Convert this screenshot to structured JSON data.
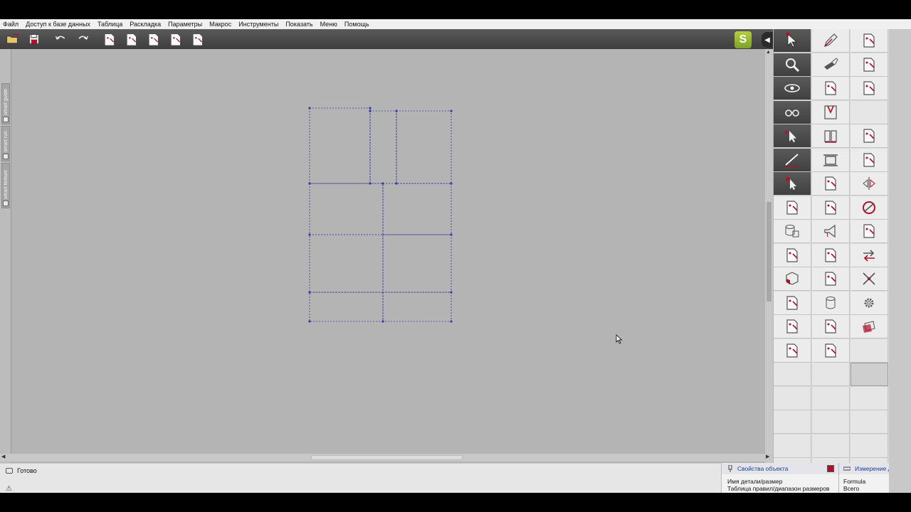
{
  "menu": {
    "items": [
      "Файл",
      "Доступ к базе данных",
      "Таблица",
      "Раскладка",
      "Параметры",
      "Макрос",
      "Инструменты",
      "Показать",
      "Меню",
      "Помощь"
    ]
  },
  "toolbar": {
    "buttons": [
      "open-file-icon",
      "save-icon",
      "undo-icon",
      "redo-icon",
      "layout-icon",
      "delete-pieces-icon",
      "list-icon",
      "piece-icon",
      "grid-icon"
    ],
    "logo": "S",
    "collapse": "◀"
  },
  "left_tabs": [
    "smart guide",
    "smart run",
    "smart texture"
  ],
  "palette": {
    "columns": [
      [
        "select-arrow-icon",
        "zoom-icon",
        "eye-icon",
        "glasses-icon",
        "add-point-arrow-icon",
        "edit-line-icon",
        "magnet-arrow-icon",
        "cross-piece-icon",
        "database-icon",
        "piece-corner-icon",
        "cube-icon",
        "piece-list-icon",
        "view-piece-icon",
        "search-piece-icon"
      ],
      [
        "pen-icon",
        "brush-icon",
        "piece-icon",
        "v-notch-icon",
        "book-icon",
        "frame-icon",
        "grid-piece-icon",
        "edit-piece-icon",
        "megaphone-icon",
        "grade-icon",
        "piece-edit-icon",
        "cylinder-icon",
        "piece-arrow-icon",
        "piece-point-icon"
      ],
      [
        "abc-piece-icon",
        "dashed-piece-icon",
        "piece-export-icon",
        "",
        "piece-plus-icon",
        "piece-arrow-right-icon",
        "mirror-icon",
        "circle-tool-icon",
        "piece-blank-icon",
        "swap-icon",
        "split-icon",
        "gear-icon",
        "stack-icon",
        ""
      ]
    ]
  },
  "status": {
    "text": "Готово",
    "warning_icon": "⚠"
  },
  "properties": {
    "title": "Свойства объекта",
    "rows": [
      "Имя детали/размер",
      "Таблица правил/диапазон размеров"
    ]
  },
  "measurement": {
    "title": "Измерение д",
    "rows": [
      "Formula",
      "Всего"
    ]
  },
  "colors": {
    "accent": "#b0102a",
    "marker_lines": "#3a3a9a",
    "toolbar_dark": "#404040",
    "link_blue": "#1a3f9a"
  }
}
